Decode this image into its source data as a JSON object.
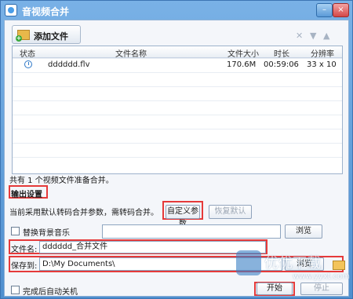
{
  "window": {
    "title": "音视频合并",
    "btn_min": "–",
    "btn_close": "×"
  },
  "toolbar": {
    "add_label": "添加文件",
    "icons": [
      "close-icon",
      "down-arrow-icon",
      "up-arrow-icon"
    ]
  },
  "table": {
    "columns": [
      "状态",
      "文件名称",
      "文件大小",
      "时长",
      "分辨率"
    ],
    "rows": [
      {
        "name": "dddddd.flv",
        "size": "170.6M",
        "duration": "00:59:06",
        "resolution": "33 x 10"
      }
    ]
  },
  "summary": "共有 1 个视频文件准备合并。",
  "output": {
    "section_title": "输出设置",
    "description": "当前采用默认转码合并参数，需转码合并。",
    "custom_params_label": "自定义参数",
    "restore_label": "恢复默认",
    "replace_bgm_label": "替换背景音乐",
    "browse_label": "浏览",
    "filename_label": "文件名:",
    "filename_value": "dddddd_合并文件",
    "saveto_label": "保存到:",
    "saveto_value": "D:\\My Documents\\",
    "auto_shutdown_label": "完成后自动关机",
    "start_label": "开始",
    "stop_label": "停止"
  },
  "watermark": {
    "text": "优优下载",
    "url": "www.yyxt.com"
  },
  "colors": {
    "highlight": "#e53a3a",
    "title_bar": "#5a94d0"
  }
}
